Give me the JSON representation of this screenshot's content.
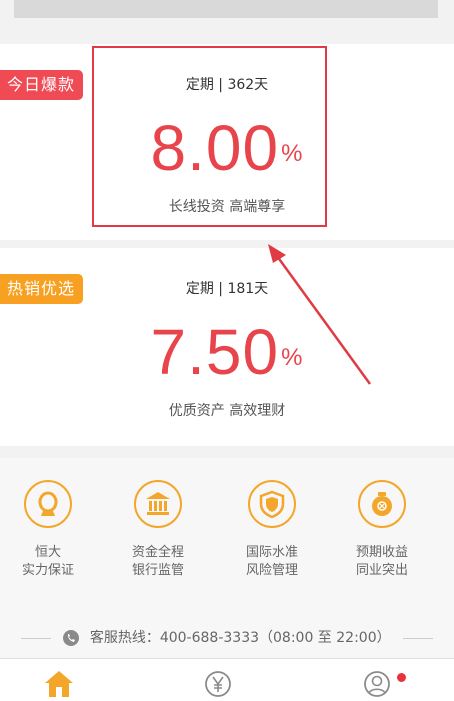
{
  "products": [
    {
      "tag": "今日爆款",
      "term": "定期 | 362天",
      "rate": "8.00",
      "rate_unit": "%",
      "desc": "长线投资 高端尊享"
    },
    {
      "tag": "热销优选",
      "term": "定期 | 181天",
      "rate": "7.50",
      "rate_unit": "%",
      "desc": "优质资产 高效理财"
    }
  ],
  "features": [
    {
      "line1": "恒大",
      "line2": "实力保证",
      "icon": "hengda-logo-icon"
    },
    {
      "line1": "资金全程",
      "line2": "银行监管",
      "icon": "bank-icon"
    },
    {
      "line1": "国际水准",
      "line2": "风险管理",
      "icon": "shield-icon"
    },
    {
      "line1": "预期收益",
      "line2": "同业突出",
      "icon": "money-bag-icon"
    }
  ],
  "hotline": "客服热线：400-688-3333（08:00 至 22:00）",
  "tabs": [
    {
      "icon": "home-icon",
      "active": true
    },
    {
      "icon": "yen-icon",
      "active": false
    },
    {
      "icon": "account-icon",
      "active": false,
      "badge": true
    }
  ],
  "colors": {
    "accent_red": "#e8444c",
    "tag_red": "#f04a55",
    "tag_orange": "#f7a021",
    "feature_orange": "#f4a62a"
  }
}
